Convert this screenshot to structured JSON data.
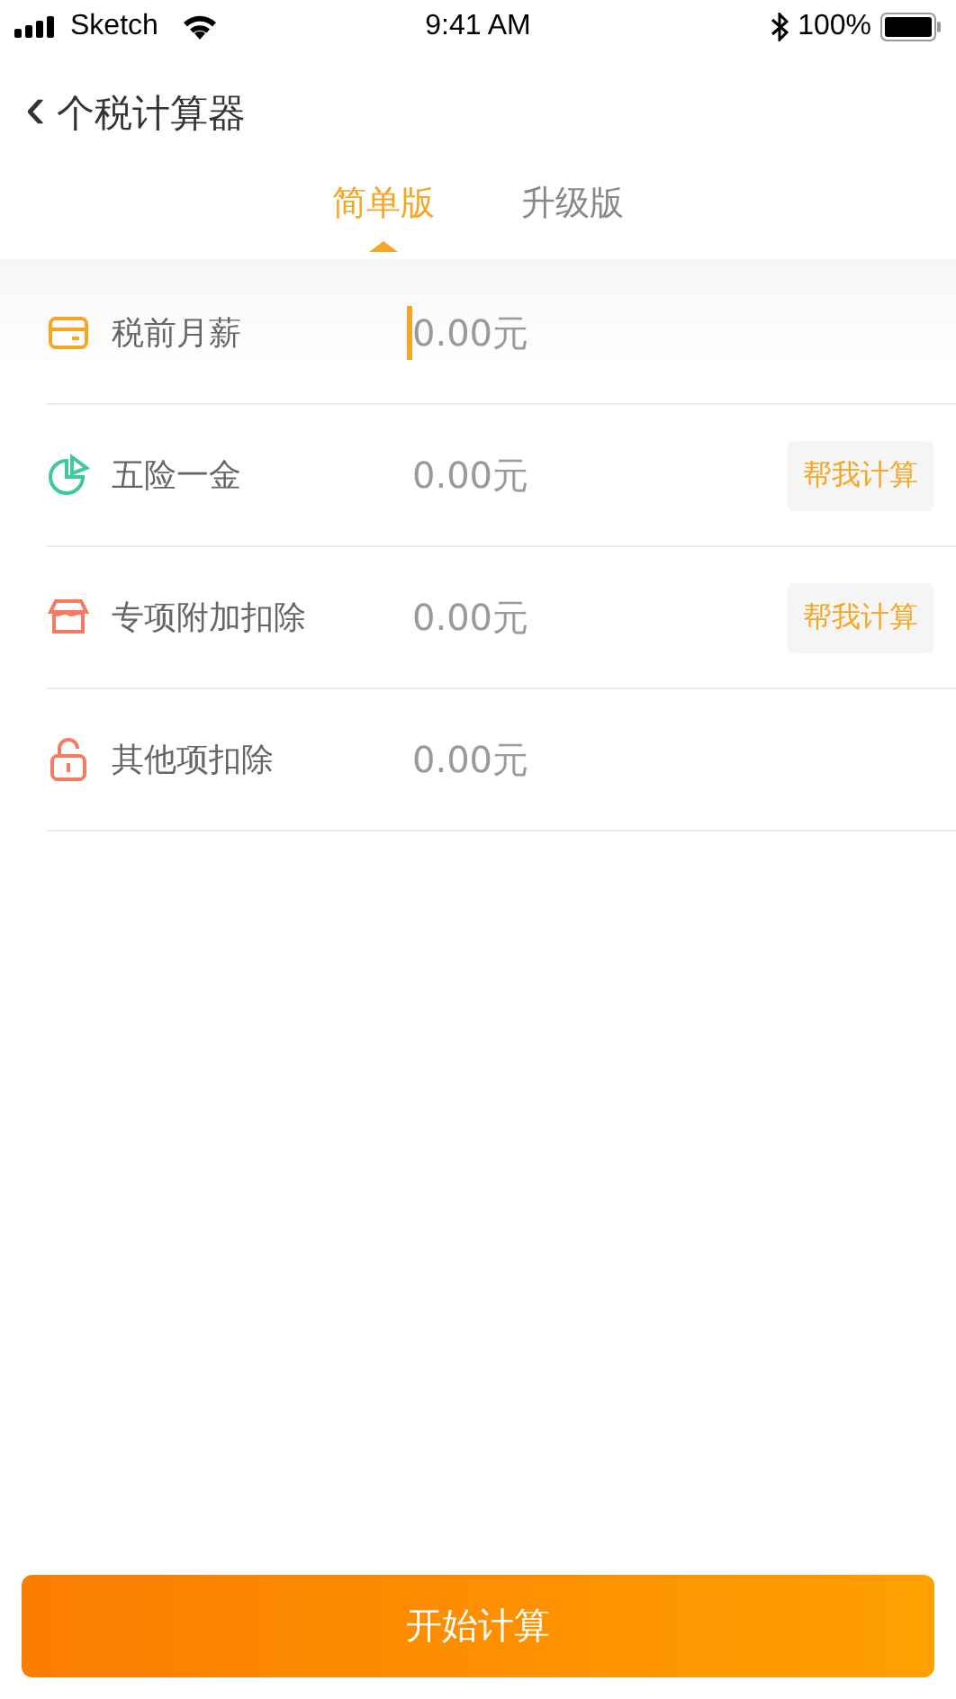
{
  "status_bar": {
    "carrier": "Sketch",
    "time": "9:41 AM",
    "battery": "100%"
  },
  "nav": {
    "back_glyph": "‹",
    "title": "个税计算器"
  },
  "tabs": [
    {
      "label": "简单版",
      "selected": true
    },
    {
      "label": "升级版",
      "selected": false
    }
  ],
  "rows": [
    {
      "kind": "card",
      "label": "税前月薪",
      "placeholder": "0.00元",
      "focused": true
    },
    {
      "kind": "pie",
      "label": "五险一金",
      "placeholder": "0.00元",
      "focused": false,
      "action": "帮我计算"
    },
    {
      "kind": "box",
      "label": "专项附加扣除",
      "placeholder": "0.00元",
      "focused": false,
      "action": "帮我计算"
    },
    {
      "kind": "lock",
      "label": "其他项扣除",
      "placeholder": "0.00元",
      "focused": false
    }
  ],
  "submit": "开始计算"
}
